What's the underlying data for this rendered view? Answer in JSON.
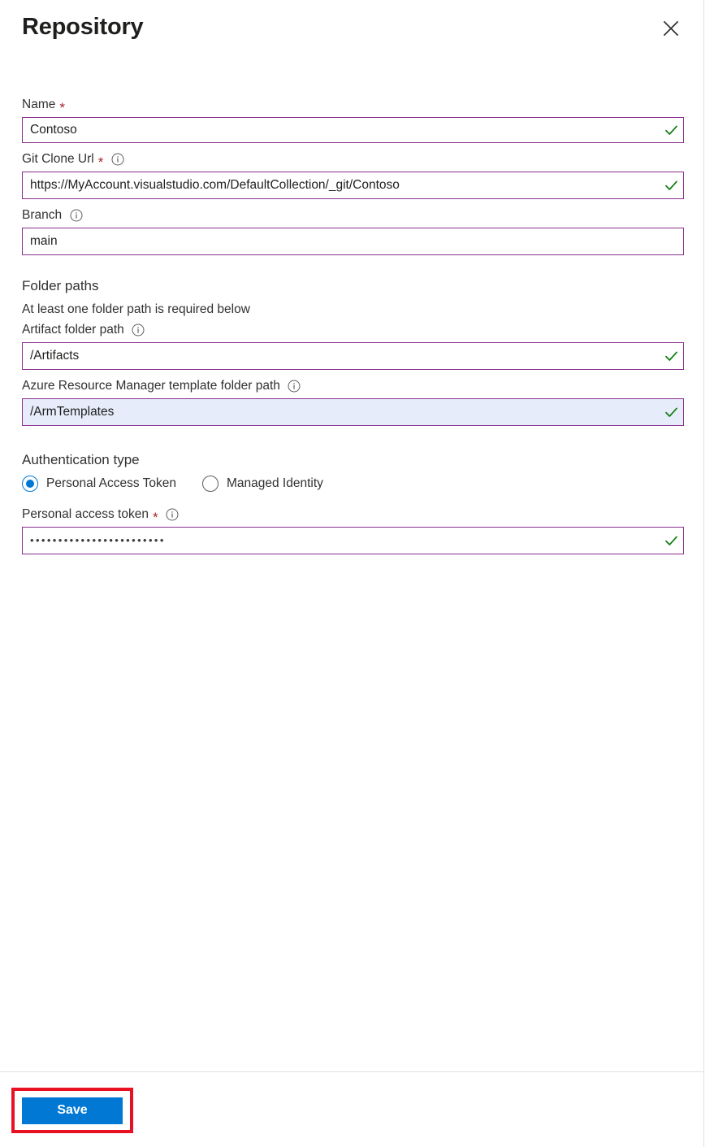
{
  "header": {
    "title": "Repository",
    "close_label": "Close"
  },
  "fields": {
    "name": {
      "label": "Name",
      "required": true,
      "value": "Contoso",
      "placeholder": "",
      "valid": true
    },
    "git_clone_url": {
      "label": "Git Clone Url",
      "required": true,
      "has_info": true,
      "value": "https://MyAccount.visualstudio.com/DefaultCollection/_git/Contoso",
      "placeholder": "",
      "valid": true
    },
    "branch": {
      "label": "Branch",
      "required": false,
      "has_info": true,
      "value": "main",
      "placeholder": "",
      "valid": false
    }
  },
  "folder_paths": {
    "heading": "Folder paths",
    "subtext": "At least one folder path is required below",
    "artifact": {
      "label": "Artifact folder path",
      "has_info": true,
      "value": "/Artifacts",
      "placeholder": "",
      "valid": true
    },
    "arm_template": {
      "label": "Azure Resource Manager template folder path",
      "has_info": true,
      "value": "/ArmTemplates",
      "placeholder": "",
      "valid": true,
      "selected": true
    }
  },
  "authentication": {
    "heading": "Authentication type",
    "options": [
      {
        "label": "Personal Access Token",
        "selected": true
      },
      {
        "label": "Managed Identity",
        "selected": false
      }
    ],
    "token": {
      "label": "Personal access token",
      "required": true,
      "has_info": true,
      "value": "••••••••••••••••••••••••",
      "valid": true
    }
  },
  "footer": {
    "save_label": "Save"
  },
  "colors": {
    "input_border": "#8a2f8d",
    "valid_check": "#107c10",
    "required_asterisk": "#a4262c",
    "primary_button": "#0078d4",
    "annotation": "#e81123",
    "selected_field_bg": "#e7ecfa"
  }
}
